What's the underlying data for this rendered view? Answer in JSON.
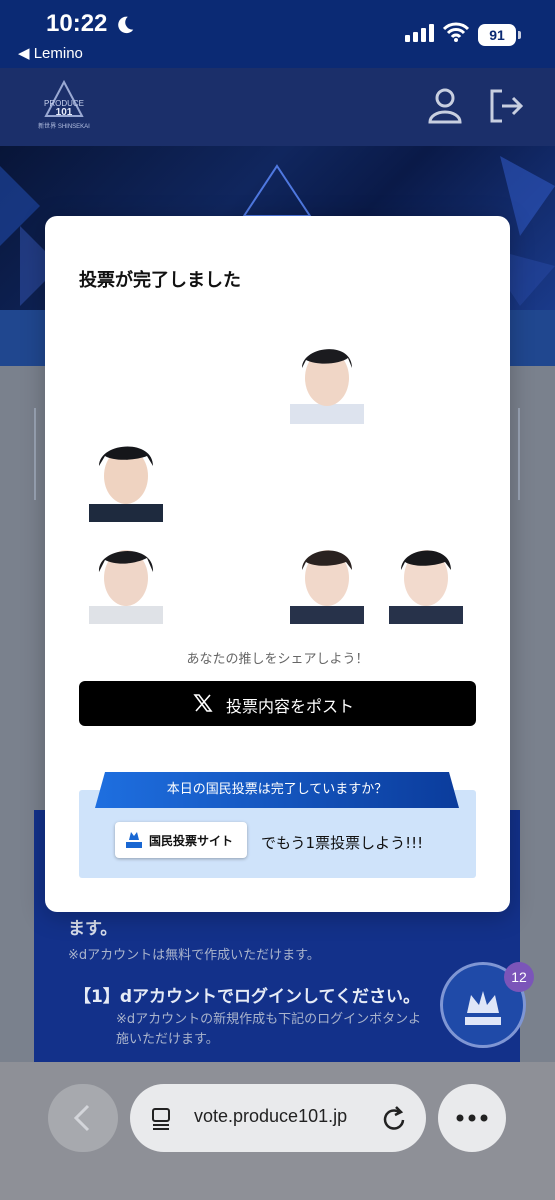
{
  "status_bar": {
    "time": "10:22",
    "back_app": "◀ Lemino",
    "battery": "91"
  },
  "site": {
    "logo": "PRODUCE 101 新世界 SHINSEKAI"
  },
  "info_panel": {
    "line_end": "ます。",
    "note1": "※dアカウントは無料で作成いただけます。",
    "step1": "【1】dアカウントでログインしてください。",
    "note2": "※dアカウントの新規作成も下記のログインボタンよ",
    "note3": "施いただけます。"
  },
  "fab": {
    "badge": "12"
  },
  "browser": {
    "url": "vote.produce101.jp"
  },
  "modal": {
    "title": "投票が完了しました",
    "share_prompt": "あなたの推しをシェアしよう！",
    "post_button": "投票内容をポスト",
    "promo_question": "本日の国民投票は完了していますか？",
    "vote_site_button": "国民投票サイト",
    "promo_cta": "でもう1票投票しよう!!!"
  },
  "icons": [
    "moon-icon",
    "signal-icon",
    "wifi-icon",
    "user-icon",
    "logout-icon",
    "x-icon",
    "tabs-icon",
    "reload-icon",
    "more-icon",
    "crown-icon",
    "back-chevron-icon"
  ],
  "colors": {
    "accent": "#0b2a74",
    "promo_blue": "#1967d2",
    "post_black": "#000000"
  }
}
